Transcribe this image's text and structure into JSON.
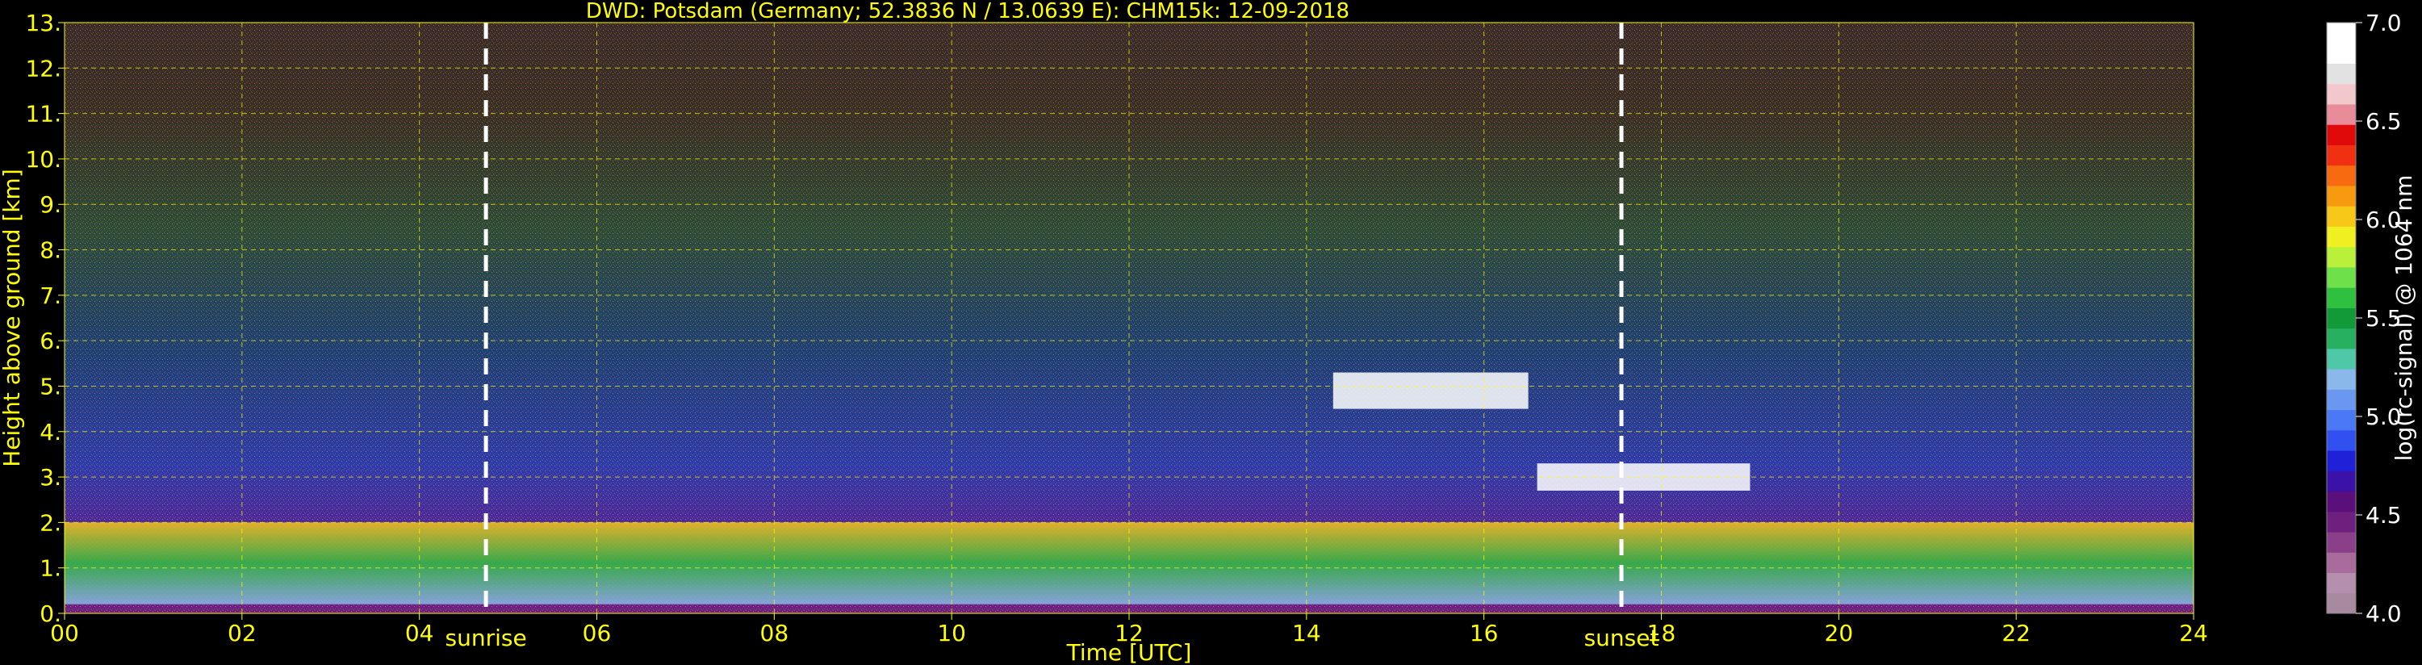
{
  "chart_data": {
    "type": "heatmap",
    "title": "DWD: Potsdam (Germany; 52.3836 N / 13.0639 E):    CHM15k: 12-09-2018",
    "xlabel": "Time [UTC]",
    "ylabel": "Height above ground [km]",
    "xlim": [
      0,
      24
    ],
    "ylim": [
      0,
      13
    ],
    "x_ticks": [
      "00",
      "02",
      "04",
      "06",
      "08",
      "10",
      "12",
      "14",
      "16",
      "18",
      "20",
      "22",
      "24"
    ],
    "y_ticks": [
      "0.",
      "1.",
      "2.",
      "3.",
      "4.",
      "5.",
      "6.",
      "7.",
      "8.",
      "9.",
      "10.",
      "11.",
      "12.",
      "13."
    ],
    "grid": true,
    "annotations": [
      {
        "label": "sunrise",
        "x": 4.75
      },
      {
        "label": "sunset",
        "x": 17.55
      }
    ],
    "colorbar": {
      "label": "log(rc-signal) @ 1064 nm",
      "range": [
        4.0,
        7.0
      ],
      "ticks": [
        "4.0",
        "4.5",
        "5.0",
        "5.5",
        "6.0",
        "6.5",
        "7.0"
      ],
      "colors": [
        "#a78aa0",
        "#b58fae",
        "#a86b9c",
        "#8b3f89",
        "#6f1f7e",
        "#5a0f7a",
        "#3a12a8",
        "#2020d8",
        "#3050f0",
        "#4b78f5",
        "#6a98f0",
        "#8ab8ea",
        "#4fc8a8",
        "#26b060",
        "#139a38",
        "#30c040",
        "#6ee04a",
        "#b8f03a",
        "#f0f020",
        "#f8c818",
        "#f89a10",
        "#f86a10",
        "#f03010",
        "#e00a0a",
        "#e88c9a",
        "#f2c8cc",
        "#e2e2e2",
        "#ffffff",
        "#ffffff"
      ]
    },
    "features": [
      {
        "name": "boundary layer",
        "x": [
          0,
          24
        ],
        "height_km": [
          0.2,
          2.0
        ],
        "log_signal": [
          5.2,
          6.0
        ]
      },
      {
        "name": "cloud layer",
        "x": [
          14.3,
          16.5
        ],
        "height_km": [
          4.5,
          5.3
        ],
        "log_signal": 7.0
      },
      {
        "name": "cloud layer",
        "x": [
          16.6,
          19.0
        ],
        "height_km": [
          2.7,
          3.3
        ],
        "log_signal": 7.0
      }
    ]
  }
}
